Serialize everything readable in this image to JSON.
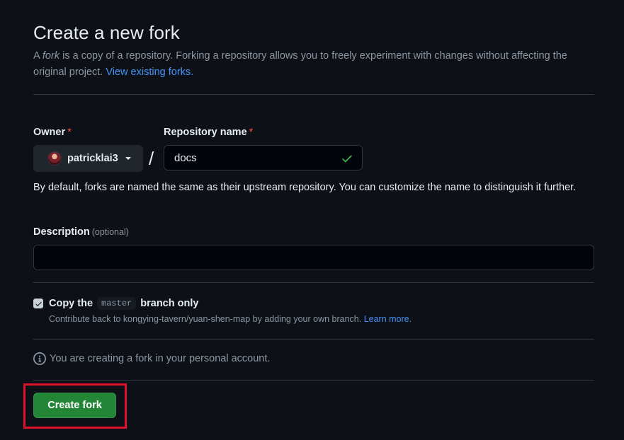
{
  "header": {
    "title": "Create a new fork",
    "intro_prefix": "A ",
    "intro_em": "fork",
    "intro_suffix": " is a copy of a repository. Forking a repository allows you to freely experiment with changes without affecting the original project. ",
    "intro_link": "View existing forks."
  },
  "owner": {
    "label": "Owner",
    "required_mark": "*",
    "value": "patricklai3"
  },
  "separator": "/",
  "repository": {
    "label": "Repository name",
    "required_mark": "*",
    "value": "docs",
    "valid_icon": "check-icon"
  },
  "name_hint": "By default, forks are named the same as their upstream repository. You can customize the name to distinguish it further.",
  "description": {
    "label": "Description",
    "optional_text": "(optional)",
    "value": ""
  },
  "copy_branch": {
    "checked": true,
    "label_prefix": "Copy the",
    "branch": "master",
    "label_suffix": "branch only",
    "sub_text": "Contribute back to kongying-tavern/yuan-shen-map by adding your own branch. ",
    "sub_link": "Learn more."
  },
  "info": {
    "icon": "info-icon",
    "text": "You are creating a fork in your personal account."
  },
  "actions": {
    "create_label": "Create fork"
  },
  "colors": {
    "background": "#0d1117",
    "primary_button": "#238636",
    "link": "#4493f8",
    "required": "#f85149",
    "highlight": "#e0112d"
  }
}
